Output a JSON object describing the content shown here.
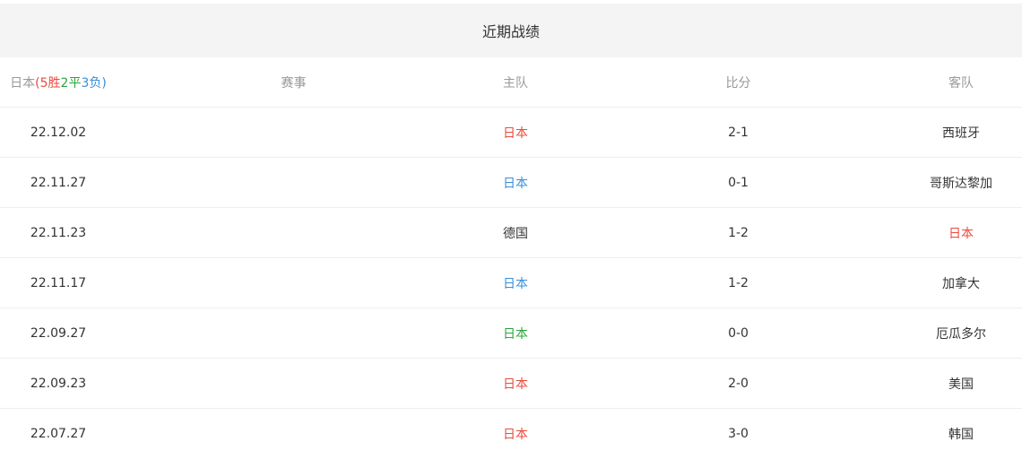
{
  "title": "近期战绩",
  "header": {
    "team": "日本",
    "open_paren": "(",
    "wins": "5胜",
    "draws": "2平",
    "losses": "3负",
    "close_paren": ")",
    "event": "赛事",
    "home": "主队",
    "score": "比分",
    "away": "客队"
  },
  "colors": {
    "win": "#e84c3d",
    "draw": "#2aa63c",
    "lose": "#3a8fd6",
    "neutral": "#333333"
  },
  "matches": [
    {
      "date": "22.12.02",
      "event": "",
      "home": "日本",
      "score": "2-1",
      "away": "西班牙",
      "home_result": "win",
      "away_result": "neutral"
    },
    {
      "date": "22.11.27",
      "event": "",
      "home": "日本",
      "score": "0-1",
      "away": "哥斯达黎加",
      "home_result": "lose",
      "away_result": "neutral"
    },
    {
      "date": "22.11.23",
      "event": "",
      "home": "德国",
      "score": "1-2",
      "away": "日本",
      "home_result": "neutral",
      "away_result": "win"
    },
    {
      "date": "22.11.17",
      "event": "",
      "home": "日本",
      "score": "1-2",
      "away": "加拿大",
      "home_result": "lose",
      "away_result": "neutral"
    },
    {
      "date": "22.09.27",
      "event": "",
      "home": "日本",
      "score": "0-0",
      "away": "厄瓜多尔",
      "home_result": "draw",
      "away_result": "neutral"
    },
    {
      "date": "22.09.23",
      "event": "",
      "home": "日本",
      "score": "2-0",
      "away": "美国",
      "home_result": "win",
      "away_result": "neutral"
    },
    {
      "date": "22.07.27",
      "event": "",
      "home": "日本",
      "score": "3-0",
      "away": "韩国",
      "home_result": "win",
      "away_result": "neutral"
    }
  ]
}
